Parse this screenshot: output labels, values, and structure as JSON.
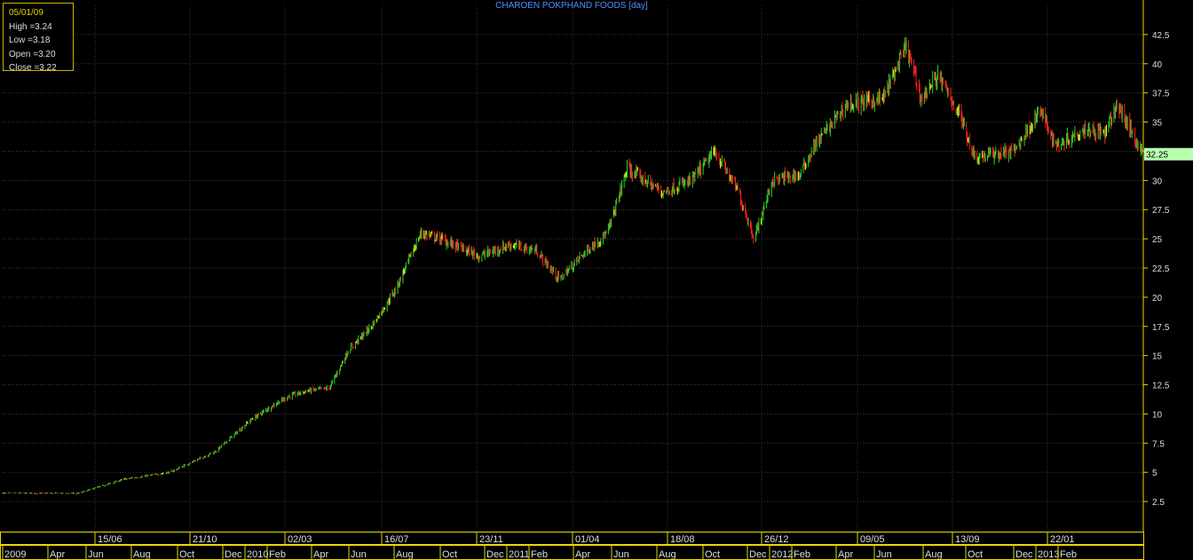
{
  "title": "CHAROEN POKPHAND FOODS [day]",
  "info": {
    "date": "05/01/09",
    "high": "High  =3.24",
    "low": "Low   =3.18",
    "open": "Open  =3.20",
    "close": "Close  =3.22"
  },
  "last_price": "32.25",
  "colors": {
    "up": "#29d629",
    "down": "#ff2020",
    "flat": "#ffff00",
    "grid": "#3a3a3a",
    "axis": "#e8d800",
    "price_tag": "#b8ffb0"
  },
  "chart_data": {
    "type": "candlestick",
    "title": "CHAROEN POKPHAND FOODS [day]",
    "x_range": [
      "2009-01-05",
      "2013-03-01"
    ],
    "ylim": [
      0,
      45
    ],
    "y_ticks": [
      2.5,
      5,
      7.5,
      10,
      12.5,
      15,
      17.5,
      20,
      22.5,
      25,
      27.5,
      30,
      32.5,
      35,
      37.5,
      40,
      42.5
    ],
    "grid": true,
    "upper_date_labels": [
      "15/06",
      "21/10",
      "02/03",
      "16/07",
      "23/11",
      "01/04",
      "18/08",
      "26/12",
      "09/05",
      "13/09",
      "22/01"
    ],
    "lower_month_labels": [
      "2009",
      "Apr",
      "Jun",
      "Aug",
      "Oct",
      "Dec",
      "2010",
      "Feb",
      "Apr",
      "Jun",
      "Aug",
      "Oct",
      "Dec",
      "2011",
      "Feb",
      "Apr",
      "Jun",
      "Aug",
      "Oct",
      "Dec",
      "2012",
      "Feb",
      "Apr",
      "Jun",
      "Aug",
      "Oct",
      "Dec",
      "2013",
      "Feb"
    ],
    "close_trend": [
      {
        "date": "2009-01-05",
        "close": 3.22
      },
      {
        "date": "2009-04-15",
        "close": 3.2
      },
      {
        "date": "2009-06-15",
        "close": 4.4
      },
      {
        "date": "2009-08-15",
        "close": 5.0
      },
      {
        "date": "2009-10-15",
        "close": 6.8
      },
      {
        "date": "2009-12-01",
        "close": 9.5
      },
      {
        "date": "2010-01-01",
        "close": 10.8
      },
      {
        "date": "2010-01-20",
        "close": 11.5
      },
      {
        "date": "2010-02-15",
        "close": 12.0
      },
      {
        "date": "2010-03-15",
        "close": 12.2
      },
      {
        "date": "2010-04-10",
        "close": 15.5
      },
      {
        "date": "2010-05-10",
        "close": 17.5
      },
      {
        "date": "2010-06-10",
        "close": 20.5
      },
      {
        "date": "2010-07-15",
        "close": 25.5
      },
      {
        "date": "2010-08-10",
        "close": 25.0
      },
      {
        "date": "2010-10-01",
        "close": 23.5
      },
      {
        "date": "2010-11-10",
        "close": 24.5
      },
      {
        "date": "2010-12-15",
        "close": 24.0
      },
      {
        "date": "2011-01-15",
        "close": 21.5
      },
      {
        "date": "2011-02-20",
        "close": 24.0
      },
      {
        "date": "2011-03-20",
        "close": 25.5
      },
      {
        "date": "2011-04-15",
        "close": 31.0
      },
      {
        "date": "2011-06-01",
        "close": 29.0
      },
      {
        "date": "2011-07-10",
        "close": 30.0
      },
      {
        "date": "2011-08-10",
        "close": 32.5
      },
      {
        "date": "2011-09-10",
        "close": 29.0
      },
      {
        "date": "2011-10-01",
        "close": 25.0
      },
      {
        "date": "2011-10-25",
        "close": 30.0
      },
      {
        "date": "2011-12-01",
        "close": 30.5
      },
      {
        "date": "2011-12-20",
        "close": 33.0
      },
      {
        "date": "2012-02-01",
        "close": 36.5
      },
      {
        "date": "2012-03-20",
        "close": 37.0
      },
      {
        "date": "2012-04-20",
        "close": 41.5
      },
      {
        "date": "2012-05-10",
        "close": 37.0
      },
      {
        "date": "2012-06-01",
        "close": 39.0
      },
      {
        "date": "2012-07-01",
        "close": 35.5
      },
      {
        "date": "2012-07-20",
        "close": 32.0
      },
      {
        "date": "2012-09-10",
        "close": 32.5
      },
      {
        "date": "2012-10-15",
        "close": 36.0
      },
      {
        "date": "2012-11-05",
        "close": 33.0
      },
      {
        "date": "2012-12-15",
        "close": 34.5
      },
      {
        "date": "2013-01-10",
        "close": 34.0
      },
      {
        "date": "2013-01-25",
        "close": 36.5
      },
      {
        "date": "2013-03-01",
        "close": 32.25
      }
    ]
  }
}
